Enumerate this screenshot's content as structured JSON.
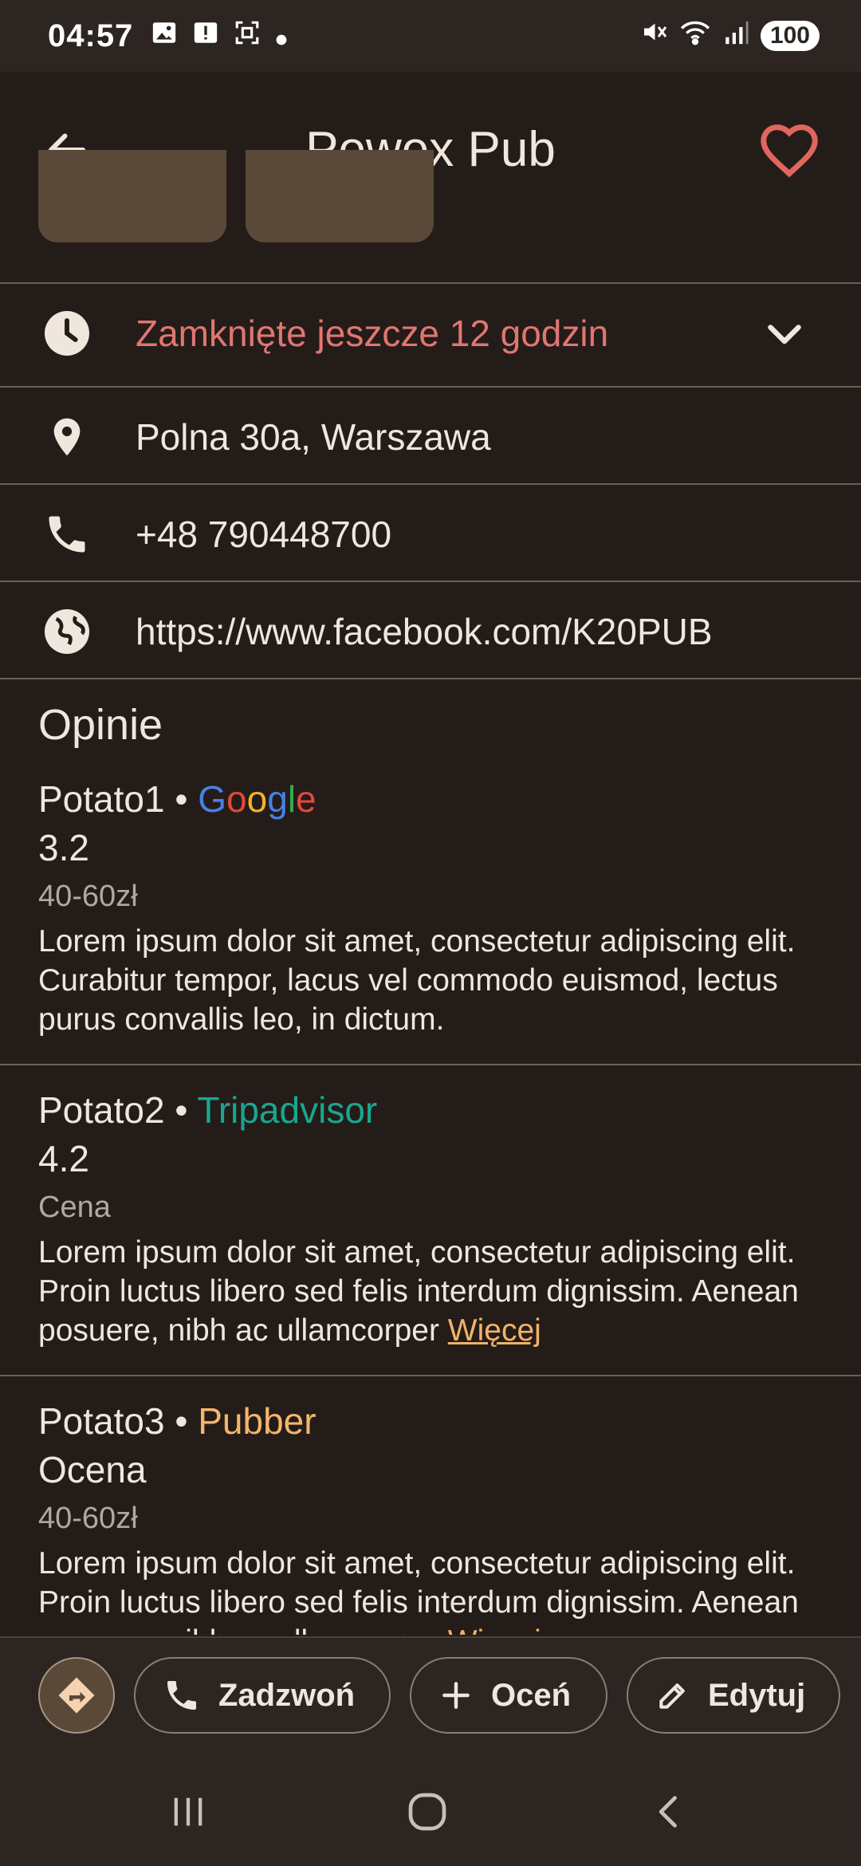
{
  "status_bar": {
    "time": "04:57",
    "battery": "100",
    "icons": [
      "image-icon",
      "warning-icon",
      "screenshot-icon",
      "dot-icon",
      "mute-icon",
      "wifi-icon",
      "signal-icon"
    ]
  },
  "app_bar": {
    "title": "Pewex Pub",
    "back_icon": "arrow-back-icon",
    "favorite_icon": "heart-outline-icon",
    "favorite_color": "#e0665e"
  },
  "info": {
    "hours_text": "Zamknięte jeszcze 12 godzin",
    "hours_color": "#e07672",
    "address": "Polna 30a, Warszawa",
    "phone": "+48 790448700",
    "website": "https://www.facebook.com/K20PUB"
  },
  "reviews_section": {
    "title": "Opinie",
    "separator": "•",
    "more_label": "Więcej",
    "items": [
      {
        "author": "Potato1",
        "source_letters": [
          "G",
          "o",
          "o",
          "g",
          "l",
          "e"
        ],
        "source_colors": [
          "#4a80e6",
          "#e2483d",
          "#f2b42a",
          "#4a80e6",
          "#36a853",
          "#e2483d"
        ],
        "rating": "3.2",
        "price": "40-60zł",
        "body": "Lorem ipsum dolor sit amet, consectetur adipiscing elit. Curabitur tempor, lacus vel commodo euismod, lectus purus convallis leo, in dictum."
      },
      {
        "author": "Potato2",
        "source": "Tripadvisor",
        "source_color": "#1aa690",
        "rating": "4.2",
        "price": "Cena",
        "body": "Lorem ipsum dolor sit amet, consectetur adipiscing elit. Proin luctus libero sed felis interdum dignissim. Aenean posuere, nibh ac ullamcorper "
      },
      {
        "author": "Potato3",
        "source": "Pubber",
        "source_color": "#f4b56c",
        "rating": "Ocena",
        "price": "40-60zł",
        "body": "Lorem ipsum dolor sit amet, consectetur adipiscing elit. Proin luctus libero sed felis interdum dignissim. Aenean posuere, nibh ac ullamcorper "
      }
    ]
  },
  "actions": {
    "directions_icon": "directions-icon",
    "call_label": "Zadzwoń",
    "rate_label": "Oceń",
    "edit_label": "Edytuj"
  },
  "nav": {
    "recents_icon": "recents-icon",
    "home_icon": "home-icon",
    "back_icon": "nav-back-icon"
  }
}
